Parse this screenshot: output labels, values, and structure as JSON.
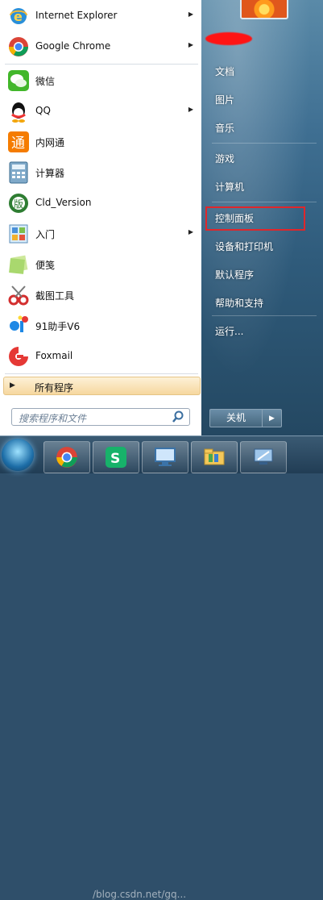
{
  "left": {
    "programs": [
      {
        "label": "Internet Explorer",
        "icon": "internet-explorer-icon",
        "has_submenu": true
      },
      {
        "label": "Google Chrome",
        "icon": "chrome-icon",
        "has_submenu": true
      },
      {
        "label": "微信",
        "icon": "wechat-icon",
        "has_submenu": false
      },
      {
        "label": "QQ",
        "icon": "qq-icon",
        "has_submenu": true
      },
      {
        "label": "内网通",
        "icon": "neiwangtong-icon",
        "has_submenu": false
      },
      {
        "label": "计算器",
        "icon": "calculator-icon",
        "has_submenu": false
      },
      {
        "label": "Cld_Version",
        "icon": "cld-version-icon",
        "has_submenu": false
      },
      {
        "label": "入门",
        "icon": "getting-started-icon",
        "has_submenu": true
      },
      {
        "label": "便笺",
        "icon": "sticky-notes-icon",
        "has_submenu": false
      },
      {
        "label": "截图工具",
        "icon": "snipping-tool-icon",
        "has_submenu": false
      },
      {
        "label": "91助手V6",
        "icon": "91-assistant-icon",
        "has_submenu": false
      },
      {
        "label": "Foxmail",
        "icon": "foxmail-icon",
        "has_submenu": false
      }
    ],
    "all_programs_label": "所有程序",
    "search_placeholder": "搜索程序和文件"
  },
  "right": {
    "items": [
      {
        "label": "文档"
      },
      {
        "label": "图片"
      },
      {
        "label": "音乐"
      },
      {
        "label": "游戏"
      },
      {
        "label": "计算机"
      },
      {
        "label": "控制面板"
      },
      {
        "label": "设备和打印机"
      },
      {
        "label": "默认程序"
      },
      {
        "label": "帮助和支持"
      },
      {
        "label": "运行..."
      }
    ],
    "shutdown_label": "关机"
  },
  "taskbar": {
    "watermark": "/blog.csdn.net/gq..."
  },
  "colors": {
    "highlight_border": "#e0262b",
    "all_programs_bg": "#f6d79f"
  }
}
